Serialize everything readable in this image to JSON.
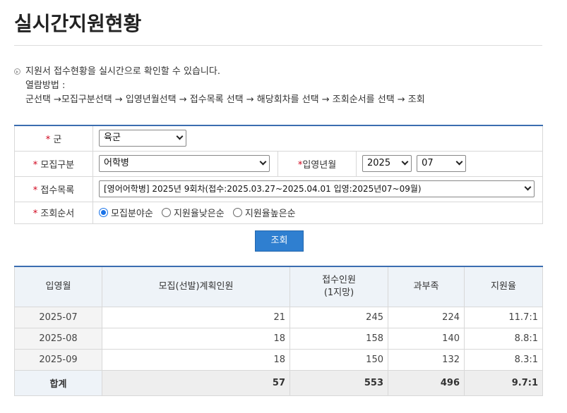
{
  "page": {
    "title": "실시간지원현황"
  },
  "guide": {
    "line1": "지원서 접수현황을 실시간으로 확인할 수 있습니다.",
    "line2": "열람방법 :",
    "line3": "군선택 →모집구분선택 → 입영년월선택 → 접수목록 선택 → 해당회차를 선택 → 조회순서를 선택 → 조회"
  },
  "form": {
    "army": {
      "label": "군",
      "value": "육군"
    },
    "recruit_type": {
      "label": "모집구분",
      "value": "어학병"
    },
    "enlist_month": {
      "label": "입영년월",
      "year": "2025",
      "month": "07"
    },
    "reception_list": {
      "label": "접수목록",
      "value": "[영어어학병] 2025년 9회차(접수:2025.03.27~2025.04.01 입영:2025년07~09월)"
    },
    "sort_order": {
      "label": "조회순서",
      "options": [
        "모집분야순",
        "지원율낮은순",
        "지원율높은순"
      ],
      "selected": "모집분야순"
    },
    "required_mark": "*"
  },
  "search_button": "조회",
  "results": {
    "headers": {
      "month": "입영월",
      "plan": "모집(선발)계획인원",
      "applied_line1": "접수인원",
      "applied_line2": "(1지망)",
      "excess": "과부족",
      "ratio": "지원율"
    },
    "rows": [
      {
        "month": "2025-07",
        "plan": "21",
        "applied": "245",
        "excess": "224",
        "ratio": "11.7:1"
      },
      {
        "month": "2025-08",
        "plan": "18",
        "applied": "158",
        "excess": "140",
        "ratio": "8.8:1"
      },
      {
        "month": "2025-09",
        "plan": "18",
        "applied": "150",
        "excess": "132",
        "ratio": "8.3:1"
      }
    ],
    "total": {
      "label": "합계",
      "plan": "57",
      "applied": "553",
      "excess": "496",
      "ratio": "9.7:1"
    }
  },
  "colors": {
    "accent": "#2f7fd0",
    "required": "#d0021b",
    "header_bg": "#eef3f8"
  }
}
